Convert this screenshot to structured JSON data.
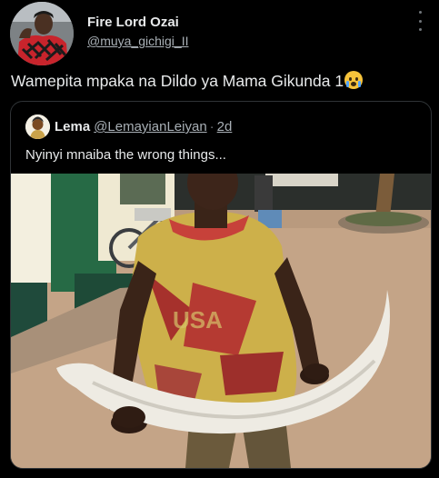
{
  "tweet": {
    "display_name": "Fire Lord Ozai",
    "handle": "@muya_gichigi_II",
    "text": "Wamepita mpaka na Dildo ya Mama Gikunda 1"
  },
  "quoted_tweet": {
    "display_name": "Lema",
    "handle": "@LemayianLeiyan",
    "separator": "·",
    "time": "2d",
    "text": "Nyinyi mnaiba the wrong things..."
  },
  "icons": {
    "more": "more-vertical-icon",
    "emoji": "crying-face-emoji-icon"
  }
}
